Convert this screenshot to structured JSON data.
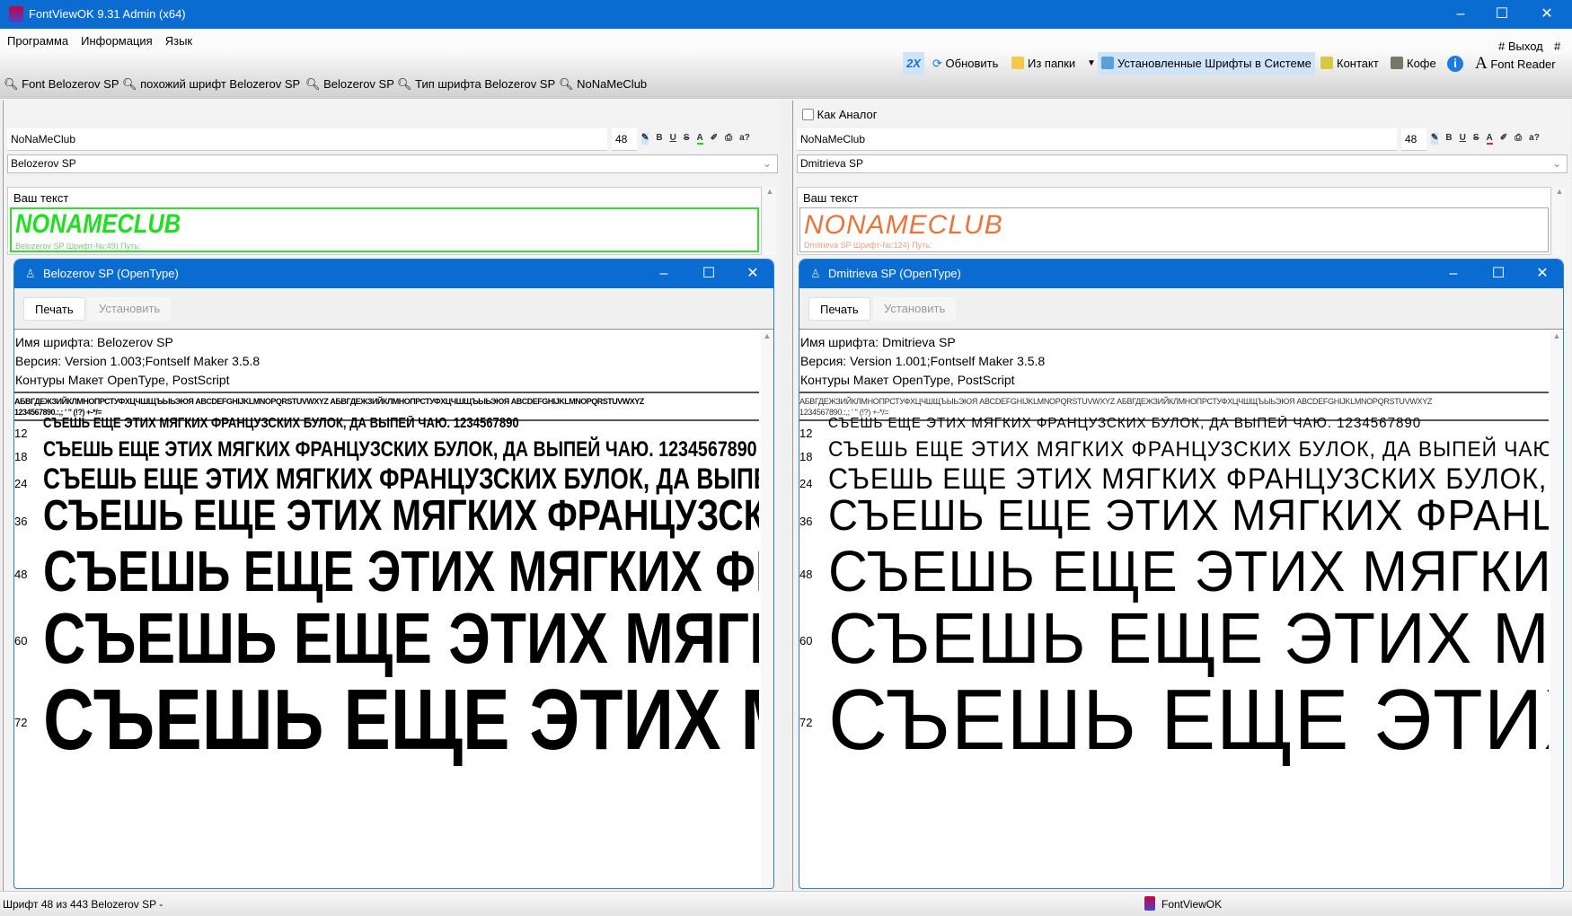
{
  "window": {
    "title": "FontViewOK 9.31 Admin (x64)",
    "minimize": "–",
    "maximize": "☐",
    "close": "✕"
  },
  "menu": [
    "Программа",
    "Информация",
    "Язык"
  ],
  "menu_right": {
    "exit": "# Выход",
    "help": "# ?"
  },
  "toolbar": {
    "twox": "2X",
    "refresh": "Обновить",
    "from_folder": "Из папки",
    "dropdown": "▼",
    "installed": "Установленные Шрифты в Системе",
    "contact": "Контакт",
    "coffee": "Кофе",
    "info": "i",
    "font_reader_icon": "A",
    "font_reader": "Font Reader"
  },
  "bookmarks": [
    "Font Belozerov SP",
    "похожий шрифт  Belozerov SP",
    "Belozerov SP",
    "Тип шрифта  Belozerov SP",
    "NoNaMeClub"
  ],
  "format": {
    "pen": "✎",
    "bold": "B",
    "underline": "U",
    "strike": "S",
    "color": "A",
    "highlight": "✐",
    "print": "⎙",
    "hint": "a?"
  },
  "sample_text": "СЪЕШЬ ЕЩЕ ЭТИХ МЯГКИХ ФРАНЦУЗСКИХ БУЛОК, ДА ВЫПЕЙ ЧАЮ. 1234567890",
  "sizes": [
    12,
    18,
    24,
    36,
    48,
    60,
    72
  ],
  "alphabet": "АБВГДЕЖЗИЙКЛМНОПРСТУФХЦЧШЩЪЫЬЭЮЯ ABCDEFGHIJKLMNOPQRSTUVWXYZ АБВГДЕЖЗИЙКЛМНОПРСТУФХЦЧШЩЪЫЬЭЮЯ ABCDEFGHIJKLMNOPQRSTUVWXYZ",
  "alphabet2": "1234567890.:,; ' \" (!?) +-*/=",
  "left": {
    "text": "NoNaMeClub",
    "size": "48",
    "font": "Belozerov SP",
    "label": "Ваш текст",
    "preview": "NONAMECLUB",
    "caption": "Belozerov SP Шрифт-№:49) Путь:",
    "color": "#22dd22",
    "dialog": {
      "title": "Belozerov SP (OpenType)",
      "print": "Печать",
      "install": "Установить",
      "name": "Имя шрифта: Belozerov SP",
      "version": "Версия: Version 1.003;Fontself Maker 3.5.8",
      "outlines": "Контуры Макет OpenType, PostScript"
    }
  },
  "right": {
    "analog": "Как Аналог",
    "text": "NoNaMeClub",
    "size": "48",
    "font": "Dmitrieva SP",
    "label": "Ваш текст",
    "preview": "NONAMECLUB",
    "caption": "Dmitrieva SP Шрифт-№:124) Путь:",
    "color": "#e8753c",
    "dialog": {
      "title": "Dmitrieva SP (OpenType)",
      "print": "Печать",
      "install": "Установить",
      "name": "Имя шрифта: Dmitrieva SP",
      "version": "Версия: Version 1.001;Fontself Maker 3.5.8",
      "outlines": "Контуры Макет OpenType, PostScript"
    }
  },
  "status": {
    "left": "Шрифт 48 из 443 Belozerov SP -",
    "app": "FontViewOK"
  }
}
